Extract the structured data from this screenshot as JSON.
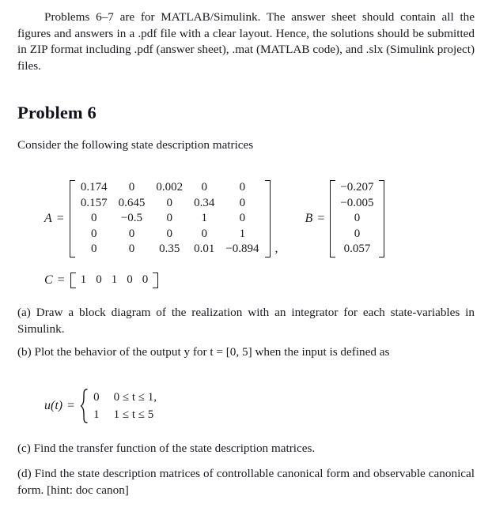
{
  "document": {
    "intro_paragraph": "Problems 6–7 are for MATLAB/Simulink.  The answer sheet should contain all the figures and answers in a .pdf file with a clear layout. Hence, the solutions should be submitted in ZIP format including .pdf (answer sheet), .mat (MATLAB code), and .slx (Simulink project) files.",
    "heading": "Problem 6",
    "consider_line": "Consider the following state description matrices",
    "equations": {
      "A": {
        "label": "A",
        "equals": "=",
        "rows": [
          [
            "0.174",
            "0",
            "0.002",
            "0",
            "0"
          ],
          [
            "0.157",
            "0.645",
            "0",
            "0.34",
            "0"
          ],
          [
            "0",
            "−0.5",
            "0",
            "1",
            "0"
          ],
          [
            "0",
            "0",
            "0",
            "0",
            "1"
          ],
          [
            "0",
            "0",
            "0.35",
            "0.01",
            "−0.894"
          ]
        ],
        "separator": ","
      },
      "B": {
        "label": "B",
        "equals": "=",
        "rows": [
          [
            "−0.207"
          ],
          [
            "−0.005"
          ],
          [
            "0"
          ],
          [
            "0"
          ],
          [
            "0.057"
          ]
        ]
      },
      "C": {
        "label": "C",
        "equals": "=",
        "rows": [
          [
            "1",
            "0",
            "1",
            "0",
            "0"
          ]
        ]
      },
      "u": {
        "label": "u(t)",
        "equals": "=",
        "cases": [
          {
            "value": "0",
            "condition": "0 ≤ t ≤ 1,"
          },
          {
            "value": "1",
            "condition": "1 ≤ t ≤ 5"
          }
        ]
      }
    },
    "parts": [
      {
        "id": "a",
        "text": "(a) Draw a block diagram of the realization with an integrator for each state-variables in Simulink."
      },
      {
        "id": "b",
        "text_before": "(b) Plot the behavior of the output y for t = [0, 5] when the input is defined as"
      },
      {
        "id": "c",
        "text": "(c) Find the transfer function of the state description matrices."
      },
      {
        "id": "d",
        "text": "(d) Find the state description matrices of controllable canonical form and observable canonical form. [hint: doc canon]"
      }
    ]
  },
  "style": {
    "text_color": "#1a1a22",
    "background_color": "#ffffff"
  }
}
